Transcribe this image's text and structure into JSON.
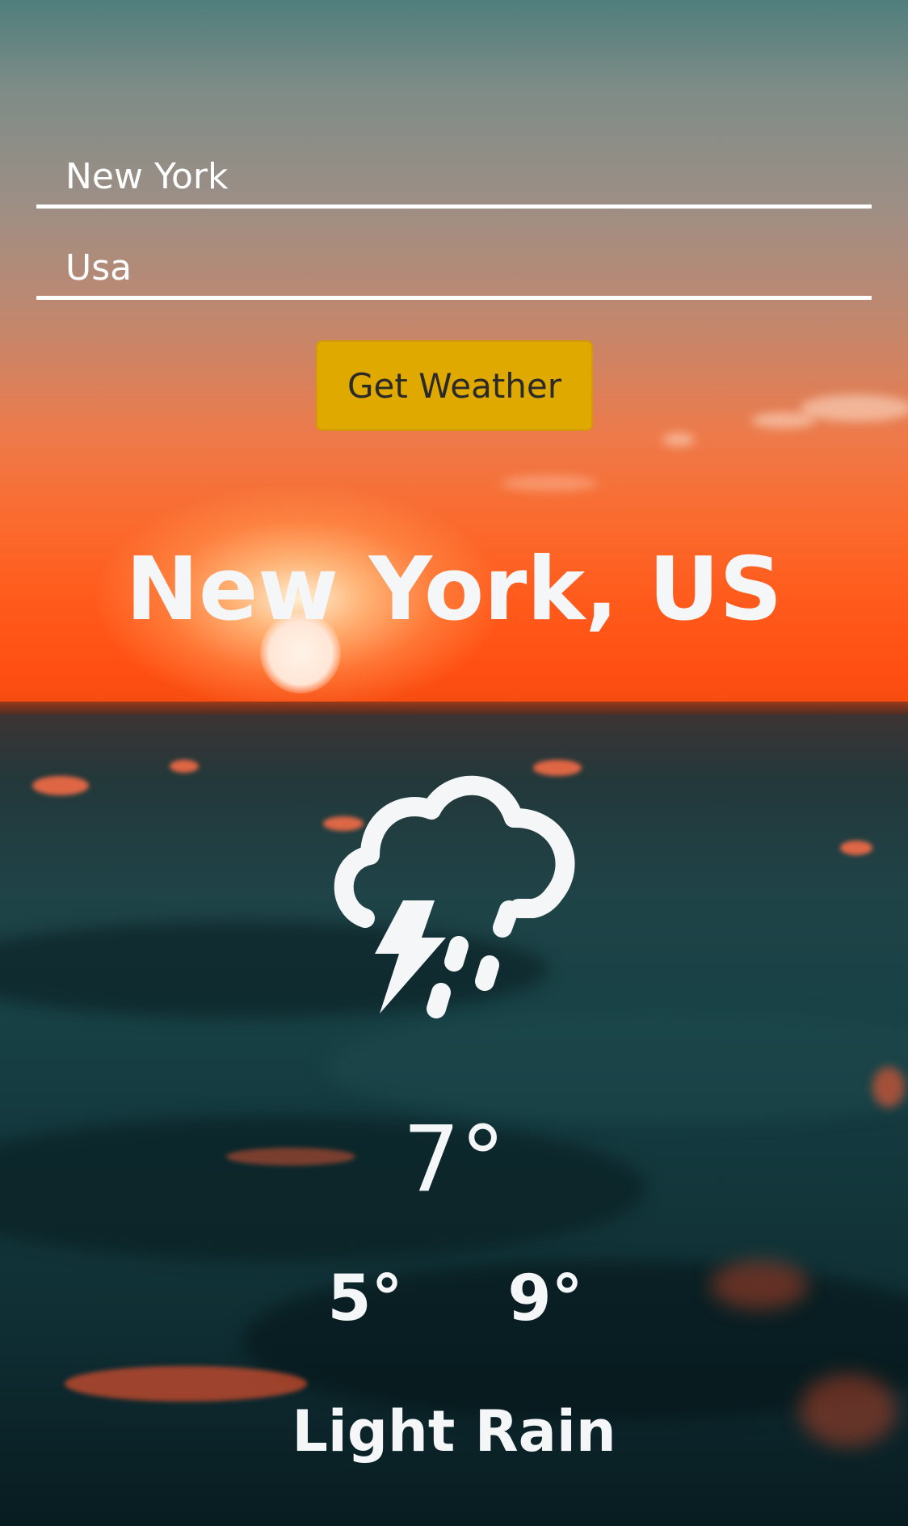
{
  "search": {
    "city_value": "New York",
    "country_value": "Usa",
    "button_label": "Get Weather"
  },
  "weather": {
    "location": "New York, US",
    "icon": "thunderstorm-rain-icon",
    "current_temp": "7°",
    "min_temp": "5°",
    "max_temp": "9°",
    "conditions": "Light Rain"
  },
  "colors": {
    "button_background": "#e0a900",
    "text": "#f4f6f8"
  }
}
